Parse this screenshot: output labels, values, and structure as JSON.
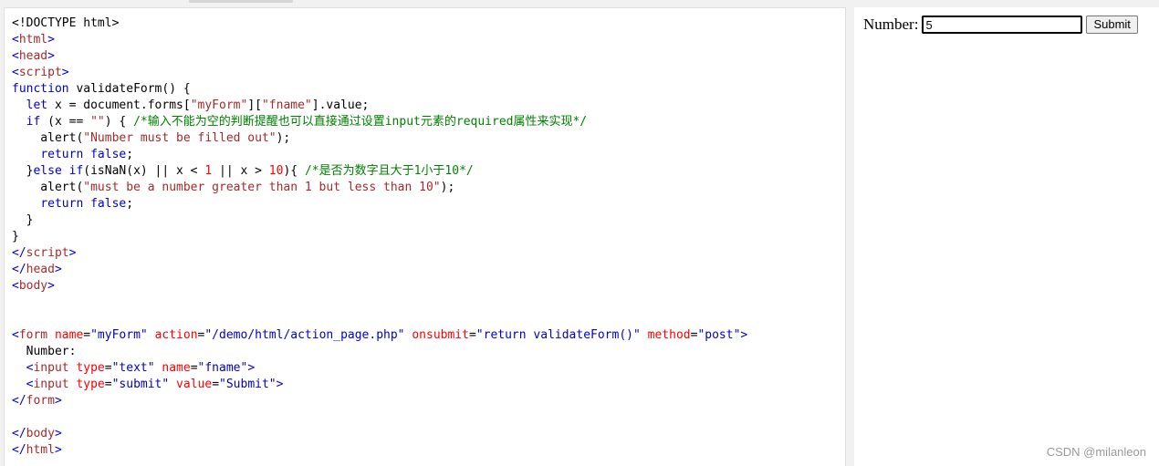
{
  "code_lines": [
    [
      [
        "txt",
        "<!DOCTYPE html>"
      ]
    ],
    [
      [
        "ang",
        "<"
      ],
      [
        "tag",
        "html"
      ],
      [
        "ang",
        ">"
      ]
    ],
    [
      [
        "ang",
        "<"
      ],
      [
        "tag",
        "head"
      ],
      [
        "ang",
        ">"
      ]
    ],
    [
      [
        "ang",
        "<"
      ],
      [
        "tag",
        "script"
      ],
      [
        "ang",
        ">"
      ]
    ],
    [
      [
        "kw",
        "function"
      ],
      [
        "txt",
        " validateForm() {"
      ]
    ],
    [
      [
        "txt",
        "  "
      ],
      [
        "kw",
        "let"
      ],
      [
        "txt",
        " x = document.forms["
      ],
      [
        "str",
        "\"myForm\""
      ],
      [
        "txt",
        "]["
      ],
      [
        "str",
        "\"fname\""
      ],
      [
        "txt",
        "].value;"
      ]
    ],
    [
      [
        "txt",
        "  "
      ],
      [
        "kw",
        "if"
      ],
      [
        "txt",
        " (x == "
      ],
      [
        "str",
        "\"\""
      ],
      [
        "txt",
        ") { "
      ],
      [
        "cmt",
        "/*输入不能为空的判断提醒也可以直接通过设置input元素的required属性来实现*/"
      ]
    ],
    [
      [
        "txt",
        "    alert("
      ],
      [
        "str",
        "\"Number must be filled out\""
      ],
      [
        "txt",
        ");"
      ]
    ],
    [
      [
        "txt",
        "    "
      ],
      [
        "kw",
        "return"
      ],
      [
        "txt",
        " "
      ],
      [
        "kw",
        "false"
      ],
      [
        "txt",
        ";"
      ]
    ],
    [
      [
        "txt",
        "  }"
      ],
      [
        "kw",
        "else"
      ],
      [
        "txt",
        " "
      ],
      [
        "kw",
        "if"
      ],
      [
        "txt",
        "(isNaN(x) || x < "
      ],
      [
        "num",
        "1"
      ],
      [
        "txt",
        " || x > "
      ],
      [
        "num",
        "10"
      ],
      [
        "txt",
        "){ "
      ],
      [
        "cmt",
        "/*是否为数字且大于1小于10*/"
      ]
    ],
    [
      [
        "txt",
        "    alert("
      ],
      [
        "str",
        "\"must be a number greater than 1 but less than 10\""
      ],
      [
        "txt",
        ");"
      ]
    ],
    [
      [
        "txt",
        "    "
      ],
      [
        "kw",
        "return"
      ],
      [
        "txt",
        " "
      ],
      [
        "kw",
        "false"
      ],
      [
        "txt",
        ";"
      ]
    ],
    [
      [
        "txt",
        "  }"
      ]
    ],
    [
      [
        "txt",
        "}"
      ]
    ],
    [
      [
        "ang",
        "</"
      ],
      [
        "tag",
        "script"
      ],
      [
        "ang",
        ">"
      ]
    ],
    [
      [
        "ang",
        "</"
      ],
      [
        "tag",
        "head"
      ],
      [
        "ang",
        ">"
      ]
    ],
    [
      [
        "ang",
        "<"
      ],
      [
        "tag",
        "body"
      ],
      [
        "ang",
        ">"
      ]
    ],
    [],
    [],
    [
      [
        "ang",
        "<"
      ],
      [
        "tag",
        "form"
      ],
      [
        "txt",
        " "
      ],
      [
        "attr",
        "name"
      ],
      [
        "txt",
        "="
      ],
      [
        "ang",
        "\"myForm\""
      ],
      [
        "txt",
        " "
      ],
      [
        "attr",
        "action"
      ],
      [
        "txt",
        "="
      ],
      [
        "ang",
        "\"/demo/html/action_page.php\""
      ],
      [
        "txt",
        " "
      ],
      [
        "attr",
        "onsubmit"
      ],
      [
        "txt",
        "="
      ],
      [
        "ang",
        "\"return validateForm()\""
      ],
      [
        "txt",
        " "
      ],
      [
        "attr",
        "method"
      ],
      [
        "txt",
        "="
      ],
      [
        "ang",
        "\"post\""
      ],
      [
        "ang",
        ">"
      ]
    ],
    [
      [
        "txt",
        "  Number:"
      ]
    ],
    [
      [
        "txt",
        "  "
      ],
      [
        "ang",
        "<"
      ],
      [
        "tag",
        "input"
      ],
      [
        "txt",
        " "
      ],
      [
        "attr",
        "type"
      ],
      [
        "txt",
        "="
      ],
      [
        "ang",
        "\"text\""
      ],
      [
        "txt",
        " "
      ],
      [
        "attr",
        "name"
      ],
      [
        "txt",
        "="
      ],
      [
        "ang",
        "\"fname\""
      ],
      [
        "ang",
        ">"
      ]
    ],
    [
      [
        "txt",
        "  "
      ],
      [
        "ang",
        "<"
      ],
      [
        "tag",
        "input"
      ],
      [
        "txt",
        " "
      ],
      [
        "attr",
        "type"
      ],
      [
        "txt",
        "="
      ],
      [
        "ang",
        "\"submit\""
      ],
      [
        "txt",
        " "
      ],
      [
        "attr",
        "value"
      ],
      [
        "txt",
        "="
      ],
      [
        "ang",
        "\"Submit\""
      ],
      [
        "ang",
        ">"
      ]
    ],
    [
      [
        "ang",
        "</"
      ],
      [
        "tag",
        "form"
      ],
      [
        "ang",
        ">"
      ]
    ],
    [],
    [
      [
        "ang",
        "</"
      ],
      [
        "tag",
        "body"
      ],
      [
        "ang",
        ">"
      ]
    ],
    [
      [
        "ang",
        "</"
      ],
      [
        "tag",
        "html"
      ],
      [
        "ang",
        ">"
      ]
    ]
  ],
  "result": {
    "number_label": "Number:",
    "input_value": "5",
    "submit_label": "Submit"
  },
  "watermark": "CSDN @milanleon"
}
